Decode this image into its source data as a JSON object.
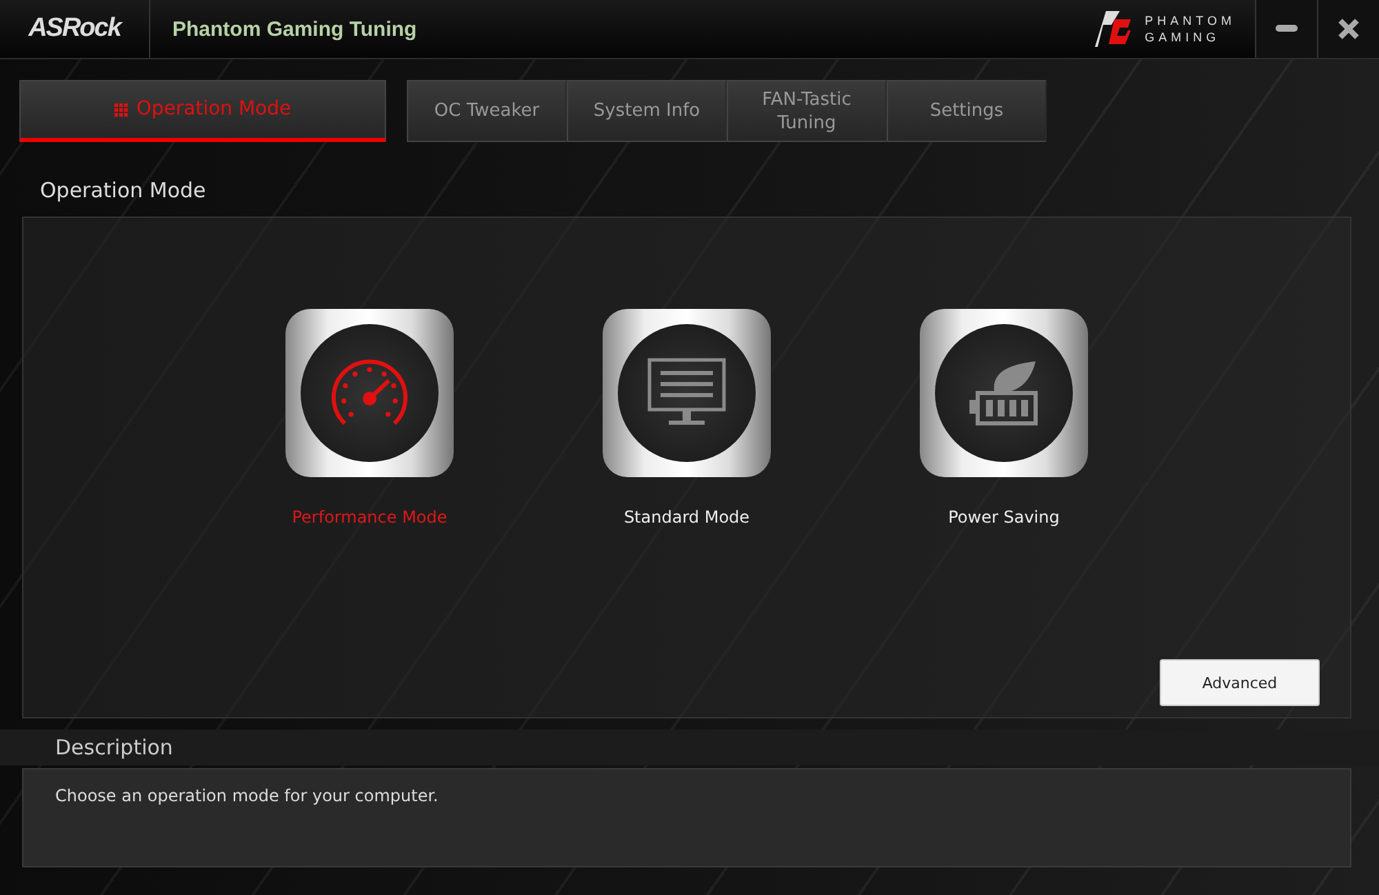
{
  "window": {
    "brand": "ASRock",
    "title": "Phantom Gaming Tuning",
    "logo_lines": [
      "PHANTOM",
      "GAMING"
    ]
  },
  "tabs": [
    {
      "label": "Operation Mode",
      "selected": true
    },
    {
      "label": "OC Tweaker",
      "selected": false
    },
    {
      "label": "System Info",
      "selected": false
    },
    {
      "label": "FAN-Tastic Tuning",
      "selected": false
    },
    {
      "label": "Settings",
      "selected": false
    }
  ],
  "section_title": "Operation Mode",
  "modes": [
    {
      "kind": "performance",
      "label": "Performance Mode",
      "selected": true
    },
    {
      "kind": "standard",
      "label": "Standard Mode",
      "selected": false
    },
    {
      "kind": "power",
      "label": "Power Saving",
      "selected": false
    }
  ],
  "advanced_button": "Advanced",
  "description": {
    "title": "Description",
    "text": "Choose an operation mode for your computer."
  }
}
